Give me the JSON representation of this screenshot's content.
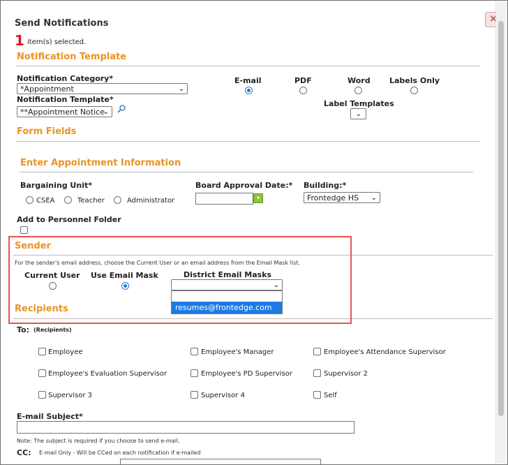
{
  "dialog": {
    "title": "Send Notifications",
    "selected_count": "1",
    "selected_text": "item(s) selected.",
    "close_label": "×"
  },
  "notification_template": {
    "heading": "Notification Template",
    "category_label": "Notification Category*",
    "category_value": "*Appointment",
    "template_label": "Notification Template*",
    "template_value": "**Appointment Notice",
    "formats": [
      {
        "label": "E-mail",
        "selected": true
      },
      {
        "label": "PDF",
        "selected": false
      },
      {
        "label": "Word",
        "selected": false
      },
      {
        "label": "Labels Only",
        "selected": false
      }
    ],
    "label_templates_label": "Label Templates"
  },
  "form_fields": {
    "heading": "Form Fields",
    "subheading": "Enter Appointment Information",
    "bargaining_unit_label": "Bargaining Unit*",
    "bargaining_options": [
      "CSEA",
      "Teacher",
      "Administrator"
    ],
    "board_approval_label": "Board Approval Date:*",
    "building_label": "Building:*",
    "building_value": "Frontedge HS",
    "personnel_folder_label": "Add to Personnel Folder"
  },
  "sender": {
    "heading": "Sender",
    "instructions": "For the sender's email address, choose the Current User or an email address from the Email Mask list.",
    "current_user_label": "Current User",
    "use_email_mask_label": "Use Email Mask",
    "district_masks_label": "District Email Masks",
    "district_masks_value": "",
    "dropdown_options": [
      "",
      "resumes@frontedge.com"
    ],
    "selected_mode": "Use Email Mask"
  },
  "recipients": {
    "heading": "Recipients",
    "to_label": "To:",
    "to_hint": "(Recipients)",
    "options": [
      "Employee",
      "Employee's Manager",
      "Employee's Attendance Supervisor",
      "Employee's Evaluation Supervisor",
      "Employee's PD Supervisor",
      "Supervisor 2",
      "Supervisor 3",
      "Supervisor 4",
      "Self"
    ]
  },
  "email": {
    "subject_label": "E-mail Subject*",
    "subject_value": "",
    "note": "Note: The subject is required if you choose to send e-mail.",
    "cc_label": "CC:",
    "cc_note": "E-mail Only - Will be CCed on each notification if e-mailed"
  },
  "colors": {
    "section": "#e89424",
    "highlight": "#e45353",
    "selected_option": "#1e7ae5",
    "date_button": "#8fc43b"
  }
}
